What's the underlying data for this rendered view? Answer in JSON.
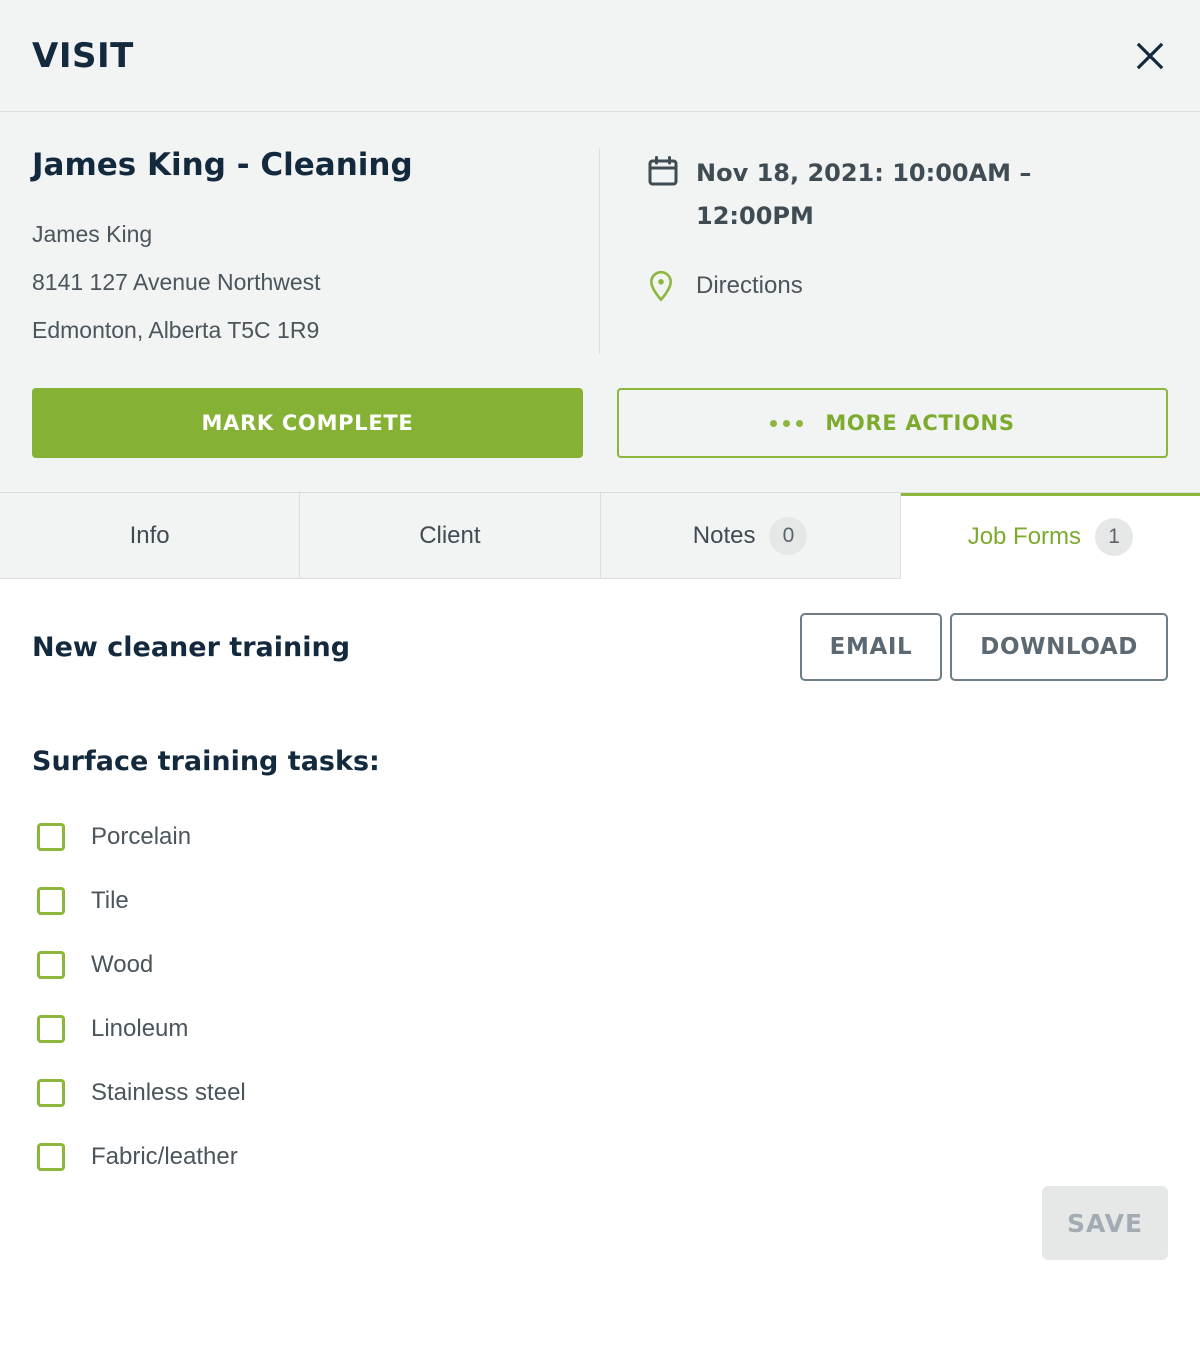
{
  "header": {
    "title": "VISIT",
    "close_icon": "close-icon"
  },
  "visit": {
    "title": "James King - Cleaning",
    "client_name": "James King",
    "address_line1": "8141 127 Avenue Northwest",
    "address_line2": "Edmonton, Alberta T5C 1R9",
    "schedule_icon": "calendar-icon",
    "schedule": "Nov 18, 2021: 10:00AM – 12:00PM",
    "directions_icon": "map-pin-icon",
    "directions_label": "Directions"
  },
  "actions": {
    "mark_complete_label": "Mark complete",
    "more_actions_label": "More actions",
    "more_actions_icon": "ellipsis-icon"
  },
  "tabs": [
    {
      "label": "Info",
      "badge": null,
      "active": false
    },
    {
      "label": "Client",
      "badge": null,
      "active": false
    },
    {
      "label": "Notes",
      "badge": "0",
      "active": false
    },
    {
      "label": "Job Forms",
      "badge": "1",
      "active": true
    }
  ],
  "job_form": {
    "name": "New cleaner training",
    "email_label": "Email",
    "download_label": "Download",
    "section_title": "Surface training tasks:",
    "tasks": [
      {
        "label": "Porcelain",
        "checked": false
      },
      {
        "label": "Tile",
        "checked": false
      },
      {
        "label": "Wood",
        "checked": false
      },
      {
        "label": "Linoleum",
        "checked": false
      },
      {
        "label": "Stainless steel",
        "checked": false
      },
      {
        "label": "Fabric/leather",
        "checked": false
      }
    ]
  },
  "footer": {
    "save_label": "Save",
    "save_disabled": true
  },
  "colors": {
    "accent_green": "#8cb73c",
    "primary_green": "#85b234",
    "navy": "#13293d",
    "slate": "#4a555c",
    "panel_bg": "#f2f3f3",
    "border": "#dcdfe0",
    "disabled_bg": "#e6e8e8"
  }
}
